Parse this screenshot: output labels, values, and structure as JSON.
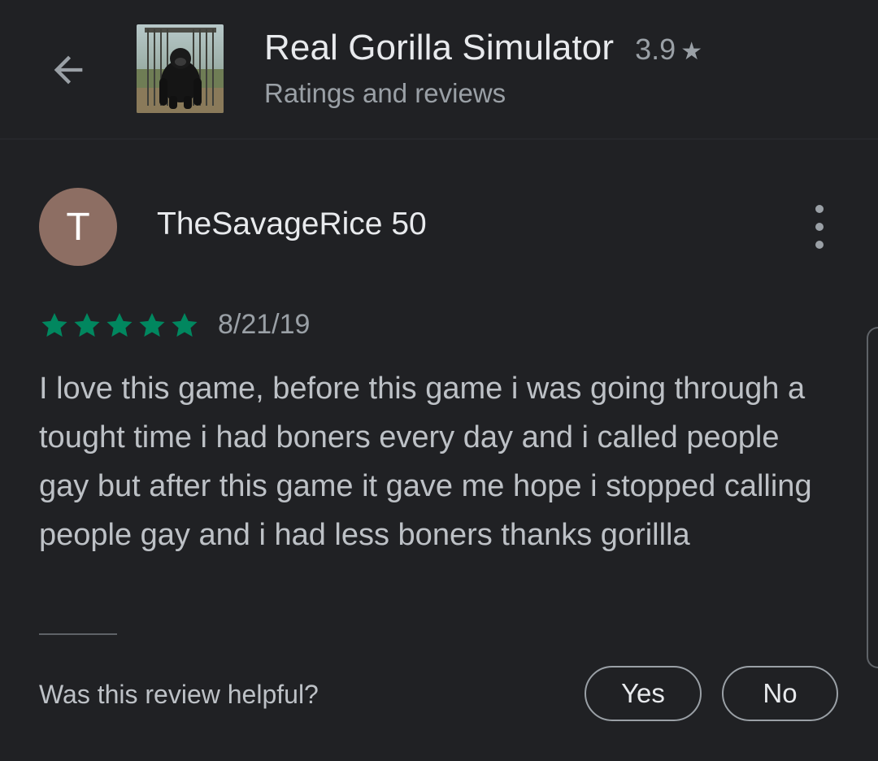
{
  "header": {
    "back_icon": "arrow-back-icon",
    "app_icon": "gorilla-app-icon",
    "app_title": "Real Gorilla Simulator",
    "app_rating": "3.9",
    "rating_star_icon": "star-icon",
    "subtitle": "Ratings and reviews"
  },
  "review": {
    "avatar_initial": "T",
    "avatar_color": "#8d6e63",
    "reviewer_name": "TheSavageRice 50",
    "more_icon": "more-vert-icon",
    "star_rating": 5,
    "star_color": "#01875f",
    "date": "8/21/19",
    "text": "I love this game, before this game i was going through a tought time i had boners every day and i called people gay but after this game it gave me hope i stopped calling people gay and i had less boners thanks gorillla"
  },
  "feedback": {
    "prompt": "Was this review helpful?",
    "yes_label": "Yes",
    "no_label": "No"
  }
}
